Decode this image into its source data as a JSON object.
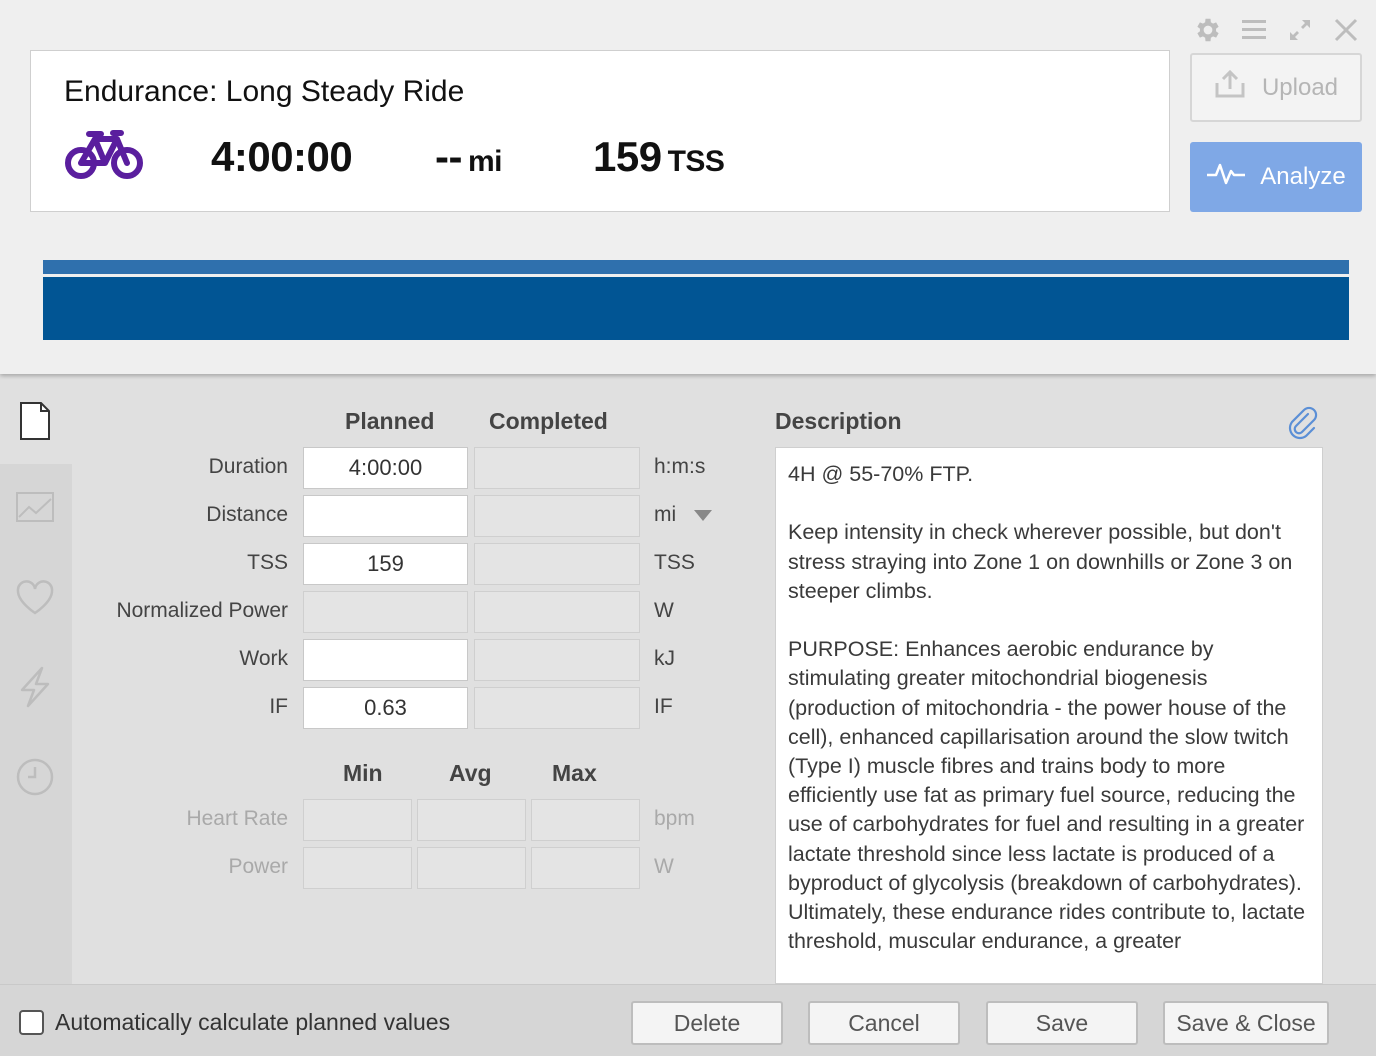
{
  "workout": {
    "title": "Endurance: Long Steady Ride",
    "sport_icon": "bike-icon",
    "duration": "4:00:00",
    "distance_value": "--",
    "distance_unit": "mi",
    "tss_value": "159",
    "tss_unit": "TSS"
  },
  "window_controls": [
    "gear-icon",
    "menu-icon",
    "expand-icon",
    "close-icon"
  ],
  "actions": {
    "upload_label": "Upload",
    "analyze_label": "Analyze"
  },
  "colors": {
    "accent": "#7fa8e6",
    "bike": "#5a1e9e",
    "bar_light": "#2f70ad",
    "bar_dark": "#015594"
  },
  "sidebar": {
    "items": [
      "document-icon",
      "chart-icon",
      "heart-icon",
      "lightning-icon",
      "clock-icon"
    ]
  },
  "form": {
    "col_planned": "Planned",
    "col_completed": "Completed",
    "rows": [
      {
        "label": "Duration",
        "planned": "4:00:00",
        "completed": "",
        "unit": "h:m:s"
      },
      {
        "label": "Distance",
        "planned": "",
        "completed": "",
        "unit": "mi"
      },
      {
        "label": "TSS",
        "planned": "159",
        "completed": "",
        "unit": "TSS"
      },
      {
        "label": "Normalized Power",
        "planned": "",
        "completed": "",
        "unit": "W"
      },
      {
        "label": "Work",
        "planned": "",
        "completed": "",
        "unit": "kJ"
      },
      {
        "label": "IF",
        "planned": "0.63",
        "completed": "",
        "unit": "IF"
      }
    ],
    "col_min": "Min",
    "col_avg": "Avg",
    "col_max": "Max",
    "range_rows": [
      {
        "label": "Heart Rate",
        "unit": "bpm"
      },
      {
        "label": "Power",
        "unit": "W"
      }
    ]
  },
  "description": {
    "heading": "Description",
    "text": "4H @ 55-70% FTP.\n\nKeep intensity in check wherever possible, but don't stress straying into Zone 1 on downhills or Zone 3 on steeper climbs.\n\nPURPOSE: Enhances aerobic endurance by stimulating greater mitochondrial biogenesis (production of mitochondria - the power house of the cell), enhanced capillarisation around the slow twitch (Type I) muscle fibres and trains body to more efficiently use fat as primary fuel source, reducing the use of carbohydrates for fuel and resulting in a greater lactate threshold since less lactate is produced of a byproduct of glycolysis (breakdown of carbohydrates). Ultimately, these endurance rides contribute to, lactate threshold, muscular endurance, a greater"
  },
  "footer": {
    "auto_calc_label": "Automatically calculate planned values",
    "delete_label": "Delete",
    "cancel_label": "Cancel",
    "save_label": "Save",
    "save_close_label": "Save & Close"
  }
}
